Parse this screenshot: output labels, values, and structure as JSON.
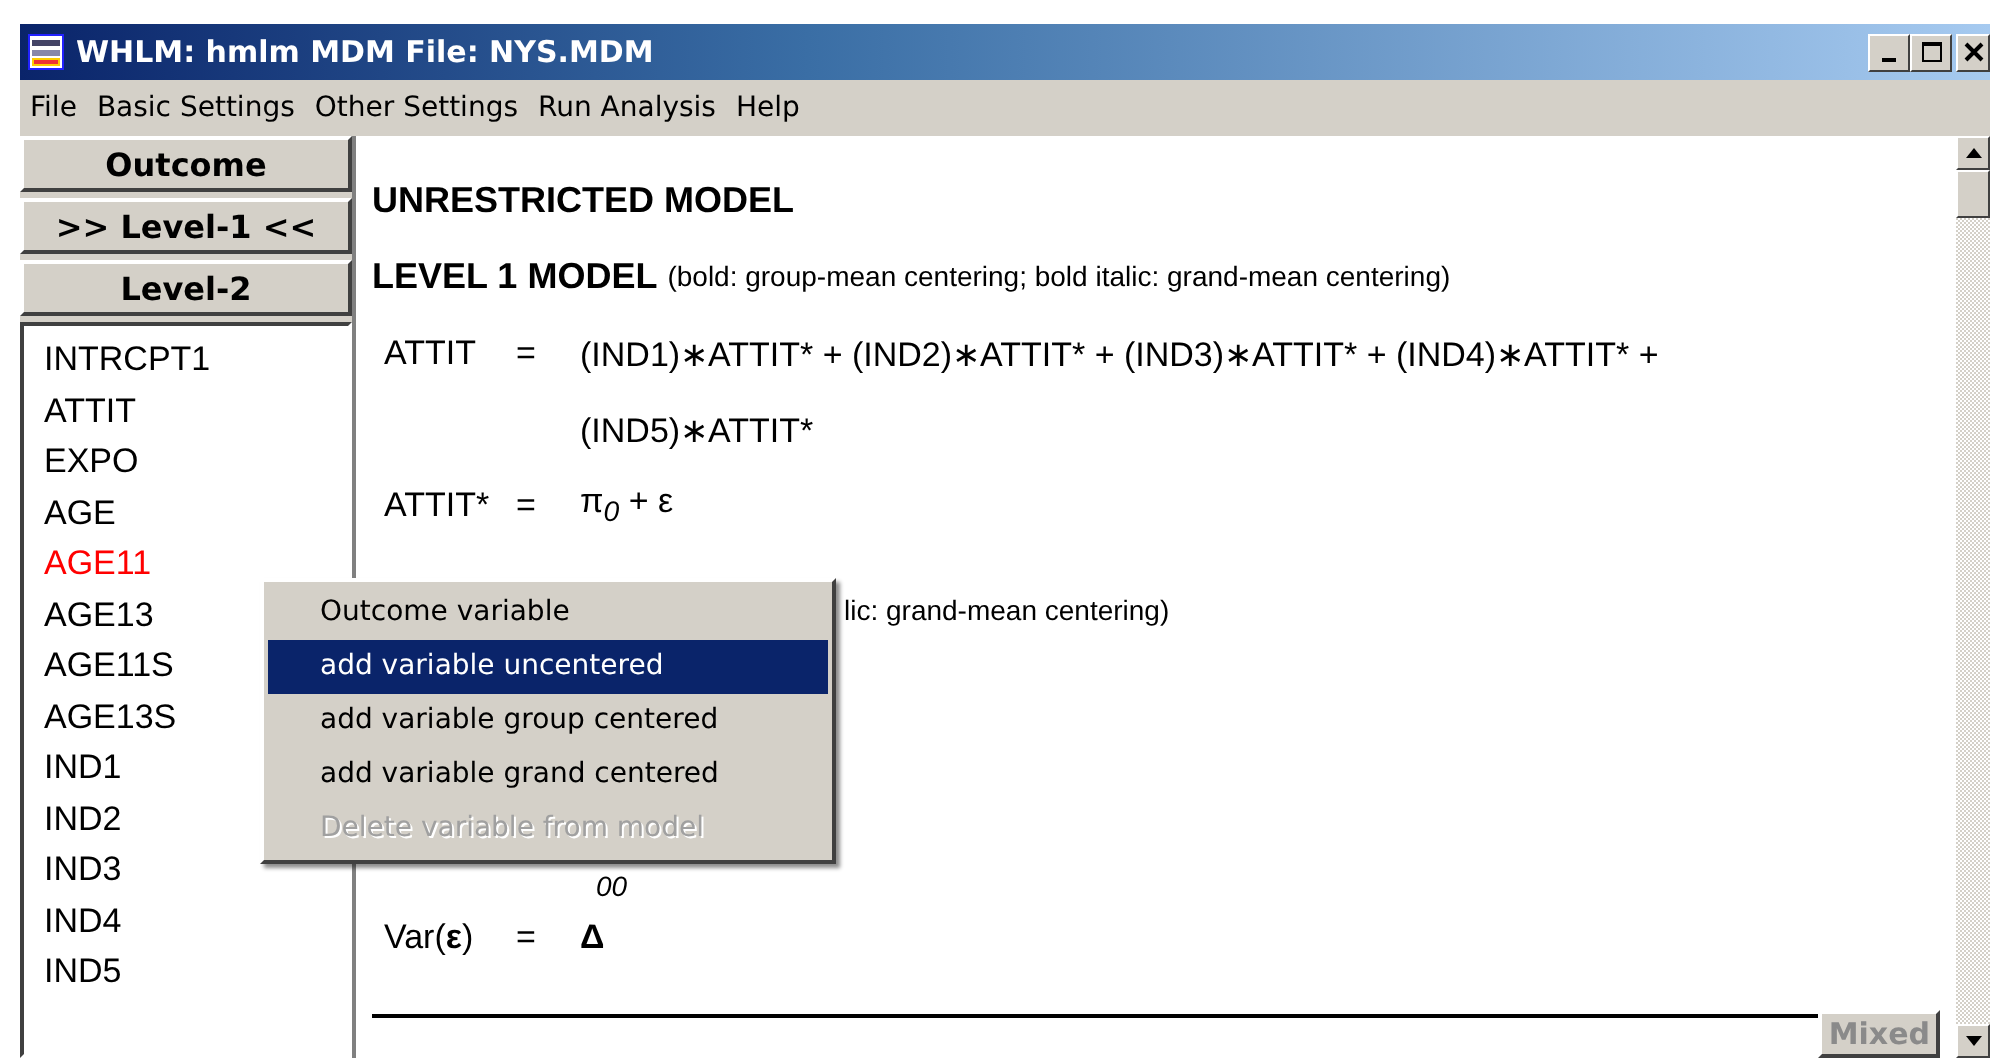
{
  "window": {
    "title": "WHLM: hmlm MDM File: NYS.MDM"
  },
  "menu": [
    "File",
    "Basic Settings",
    "Other Settings",
    "Run Analysis",
    "Help"
  ],
  "level_buttons": [
    "Outcome",
    ">> Level-1 <<",
    "Level-2"
  ],
  "variables": [
    {
      "label": "INTRCPT1",
      "selected": false
    },
    {
      "label": "ATTIT",
      "selected": false
    },
    {
      "label": "EXPO",
      "selected": false
    },
    {
      "label": "AGE",
      "selected": false
    },
    {
      "label": "AGE11",
      "selected": true
    },
    {
      "label": "AGE13",
      "selected": false
    },
    {
      "label": "AGE11S",
      "selected": false
    },
    {
      "label": "AGE13S",
      "selected": false
    },
    {
      "label": "IND1",
      "selected": false
    },
    {
      "label": "IND2",
      "selected": false
    },
    {
      "label": "IND3",
      "selected": false
    },
    {
      "label": "IND4",
      "selected": false
    },
    {
      "label": "IND5",
      "selected": false
    }
  ],
  "model": {
    "heading": "UNRESTRICTED MODEL",
    "level1_title": "LEVEL 1 MODEL",
    "level1_note": "(bold: group-mean centering; bold italic: grand-mean centering)",
    "equation1": {
      "lhs": "ATTIT",
      "eq": "=",
      "rhs": "(IND1)∗ATTIT* + (IND2)∗ATTIT* + (IND3)∗ATTIT* + (IND4)∗ATTIT* +",
      "continuation": "(IND5)∗ATTIT*"
    },
    "equation2": {
      "lhs": "ATTIT*",
      "eq": "=",
      "rhs": "π$_{0}$ + ε"
    },
    "covered_note": "lic: grand-mean centering)",
    "covered_subscript": "00",
    "variance": {
      "lhs": "Var(**ε**)",
      "eq": "=",
      "rhs": "Δ"
    }
  },
  "context_menu": [
    {
      "label": "Outcome variable",
      "selected": false,
      "disabled": false
    },
    {
      "label": "add variable uncentered",
      "selected": true,
      "disabled": false
    },
    {
      "label": "add variable group centered",
      "selected": false,
      "disabled": false
    },
    {
      "label": "add variable grand centered",
      "selected": false,
      "disabled": false
    },
    {
      "label": "Delete variable from model",
      "selected": false,
      "disabled": true
    }
  ],
  "mode_button": {
    "label": "Mixed",
    "disabled": true
  }
}
